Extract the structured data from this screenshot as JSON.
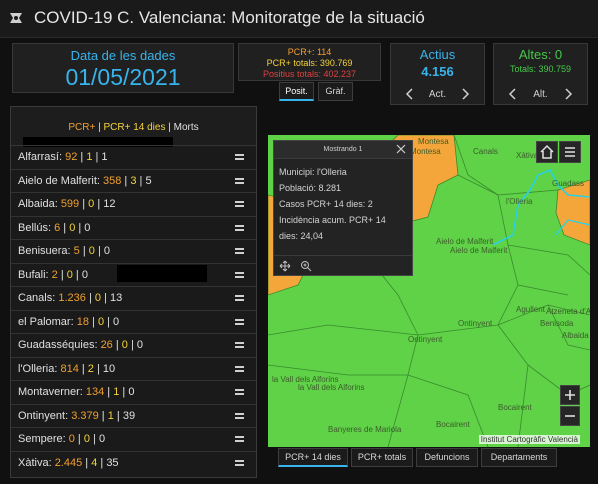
{
  "app": {
    "title": "COVID-19 C. Valenciana: Monitoratge de la situació",
    "icon": "app-logo-icon"
  },
  "date_panel": {
    "label": "Data de les dades",
    "value": "01/05/2021"
  },
  "pcr_panel": {
    "line1": "PCR+: 114",
    "line2": "PCR+ totals: 390.769",
    "line3": "Positius totals: 402.237",
    "tabs": [
      "Posit.",
      "Gràf."
    ]
  },
  "actius_panel": {
    "title": "Actius",
    "value": "4.156",
    "nav_label": "Act."
  },
  "altes_panel": {
    "title": "Altes: 0",
    "subtitle": "Totals: 390.759",
    "nav_label": "Alt."
  },
  "list": {
    "legend": {
      "pcr": "PCR+",
      "sep1": " | ",
      "pcr14": "PCR+ 14 dies",
      "sep2": " | ",
      "morts": "Morts"
    },
    "rows": [
      {
        "name": "Alfarrasí: ",
        "pcr": "92",
        "pcr14": "1",
        "morts": "1"
      },
      {
        "name": "Aielo de Malferit: ",
        "pcr": "358",
        "pcr14": "3",
        "morts": "5"
      },
      {
        "name": "Albaida: ",
        "pcr": "599",
        "pcr14": "0",
        "morts": "12"
      },
      {
        "name": "Bellús: ",
        "pcr": "6",
        "pcr14": "0",
        "morts": "0"
      },
      {
        "name": "Benisuera: ",
        "pcr": "5",
        "pcr14": "0",
        "morts": "0"
      },
      {
        "name": "Bufali: ",
        "pcr": "2",
        "pcr14": "0",
        "morts": "0"
      },
      {
        "name": "Canals: ",
        "pcr": "1.236",
        "pcr14": "0",
        "morts": "13"
      },
      {
        "name": "el Palomar: ",
        "pcr": "18",
        "pcr14": "0",
        "morts": "0"
      },
      {
        "name": "Guadasséquies: ",
        "pcr": "26",
        "pcr14": "0",
        "morts": "0"
      },
      {
        "name": "l'Olleria: ",
        "pcr": "814",
        "pcr14": "2",
        "morts": "10"
      },
      {
        "name": "Montaverner: ",
        "pcr": "134",
        "pcr14": "1",
        "morts": "0"
      },
      {
        "name": "Ontinyent: ",
        "pcr": "3.379",
        "pcr14": "1",
        "morts": "39"
      },
      {
        "name": "Sempere: ",
        "pcr": "0",
        "pcr14": "0",
        "morts": "0"
      },
      {
        "name": "Xàtiva: ",
        "pcr": "2.445",
        "pcr14": "4",
        "morts": "35"
      }
    ]
  },
  "popup": {
    "title": "Mostrando 1",
    "lines": [
      "Municipi: l'Olleria",
      "Població: 8.281",
      "Casos PCR+ 14 dies: 2",
      "Incidència acum. PCR+ 14",
      "dies: 24,04"
    ]
  },
  "map": {
    "labels": [
      "Montesa",
      "Montesa",
      "Canals",
      "Xàtiva",
      "Guadass",
      "l'Olleria",
      "Aielo de Malferit",
      "Aielo de Malferit",
      "Agullent",
      "Benisoda",
      "Atzeneta d'Albaida",
      "Albaida",
      "Ontinyent",
      "Ontinyent",
      "Bocairent",
      "Banyeres de Mariola",
      "Bocairent",
      "la Vall dels Alforins",
      "la Vall dels Alforins"
    ],
    "attribution": "Institut Cartogràfic Valencià",
    "colors": {
      "low": "#5fd248",
      "medium": "#f5a63a",
      "border": "#3a8a2c"
    }
  },
  "map_tabs": [
    "PCR+ 14 dies",
    "PCR+ totals",
    "Defuncions",
    "Departaments"
  ],
  "accent": "#38b4ec"
}
